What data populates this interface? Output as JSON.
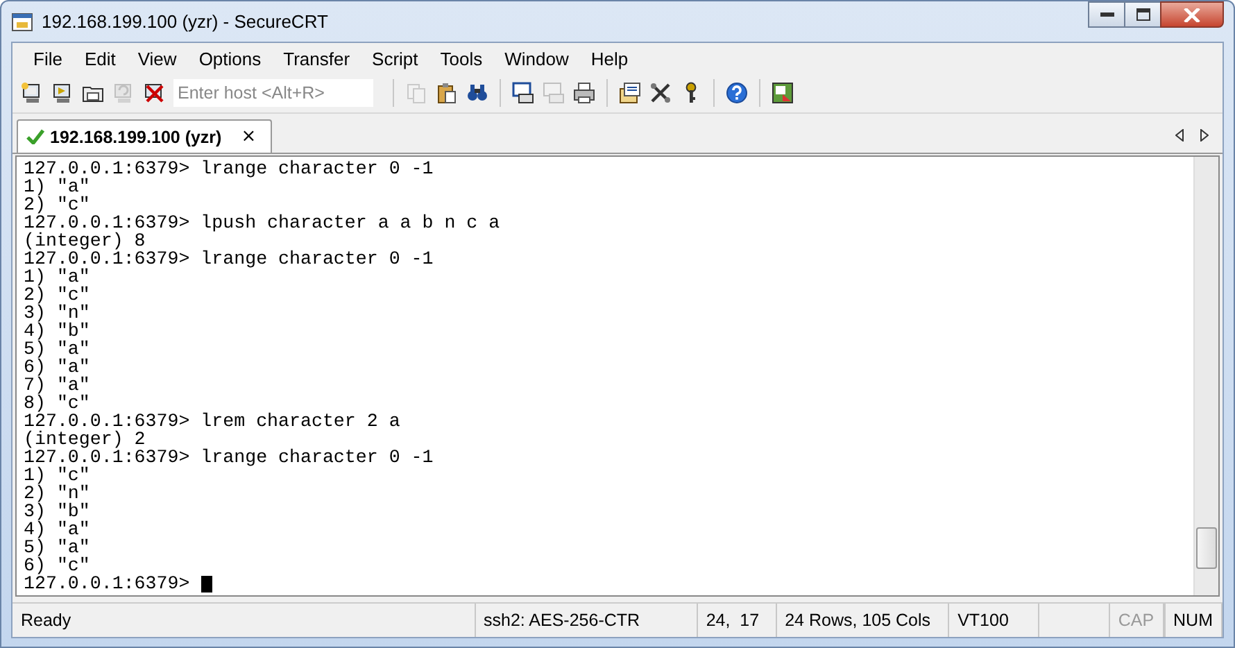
{
  "window": {
    "title": "192.168.199.100 (yzr) - SecureCRT"
  },
  "menu": [
    "File",
    "Edit",
    "View",
    "Options",
    "Transfer",
    "Script",
    "Tools",
    "Window",
    "Help"
  ],
  "toolbar": {
    "buttons": [
      {
        "kind": "connect",
        "disabled": false
      },
      {
        "kind": "quick-connect",
        "disabled": false
      },
      {
        "kind": "folder",
        "disabled": false
      },
      {
        "kind": "reconnect",
        "disabled": true
      },
      {
        "kind": "disconnect",
        "disabled": false
      },
      {
        "kind": "host-field",
        "placeholder": "Enter host <Alt+R>"
      },
      {
        "kind": "separator"
      },
      {
        "kind": "copy",
        "disabled": true
      },
      {
        "kind": "paste",
        "disabled": false
      },
      {
        "kind": "find",
        "disabled": false
      },
      {
        "kind": "separator"
      },
      {
        "kind": "print-screen",
        "disabled": false
      },
      {
        "kind": "print-selection",
        "disabled": true
      },
      {
        "kind": "print",
        "disabled": false
      },
      {
        "kind": "separator"
      },
      {
        "kind": "options",
        "disabled": false
      },
      {
        "kind": "tools",
        "disabled": false
      },
      {
        "kind": "key",
        "disabled": false
      },
      {
        "kind": "separator"
      },
      {
        "kind": "help",
        "disabled": false
      },
      {
        "kind": "separator"
      },
      {
        "kind": "map",
        "disabled": false
      }
    ]
  },
  "tabs": [
    {
      "label": "192.168.199.100 (yzr)",
      "selected": true,
      "connected": true,
      "close": "×"
    }
  ],
  "terminal": {
    "cursor": true,
    "lines": [
      "127.0.0.1:6379> lrange character 0 -1",
      "1) \"a\"",
      "2) \"c\"",
      "127.0.0.1:6379> lpush character a a b n c a",
      "(integer) 8",
      "127.0.0.1:6379> lrange character 0 -1",
      "1) \"a\"",
      "2) \"c\"",
      "3) \"n\"",
      "4) \"b\"",
      "5) \"a\"",
      "6) \"a\"",
      "7) \"a\"",
      "8) \"c\"",
      "127.0.0.1:6379> lrem character 2 a",
      "(integer) 2",
      "127.0.0.1:6379> lrange character 0 -1",
      "1) \"c\"",
      "2) \"n\"",
      "3) \"b\"",
      "4) \"a\"",
      "5) \"a\"",
      "6) \"c\"",
      "127.0.0.1:6379> "
    ]
  },
  "status_bar": [
    {
      "kind": "text",
      "text": "Ready"
    },
    {
      "kind": "text",
      "text": "ssh2: AES-256-CTR"
    },
    {
      "kind": "text",
      "text": "24,  17"
    },
    {
      "kind": "text",
      "text": "24 Rows, 105 Cols"
    },
    {
      "kind": "text",
      "text": "VT100"
    },
    {
      "kind": "indicator",
      "text": "CAP",
      "on": false
    },
    {
      "kind": "indicator",
      "text": "NUM",
      "on": true
    }
  ]
}
